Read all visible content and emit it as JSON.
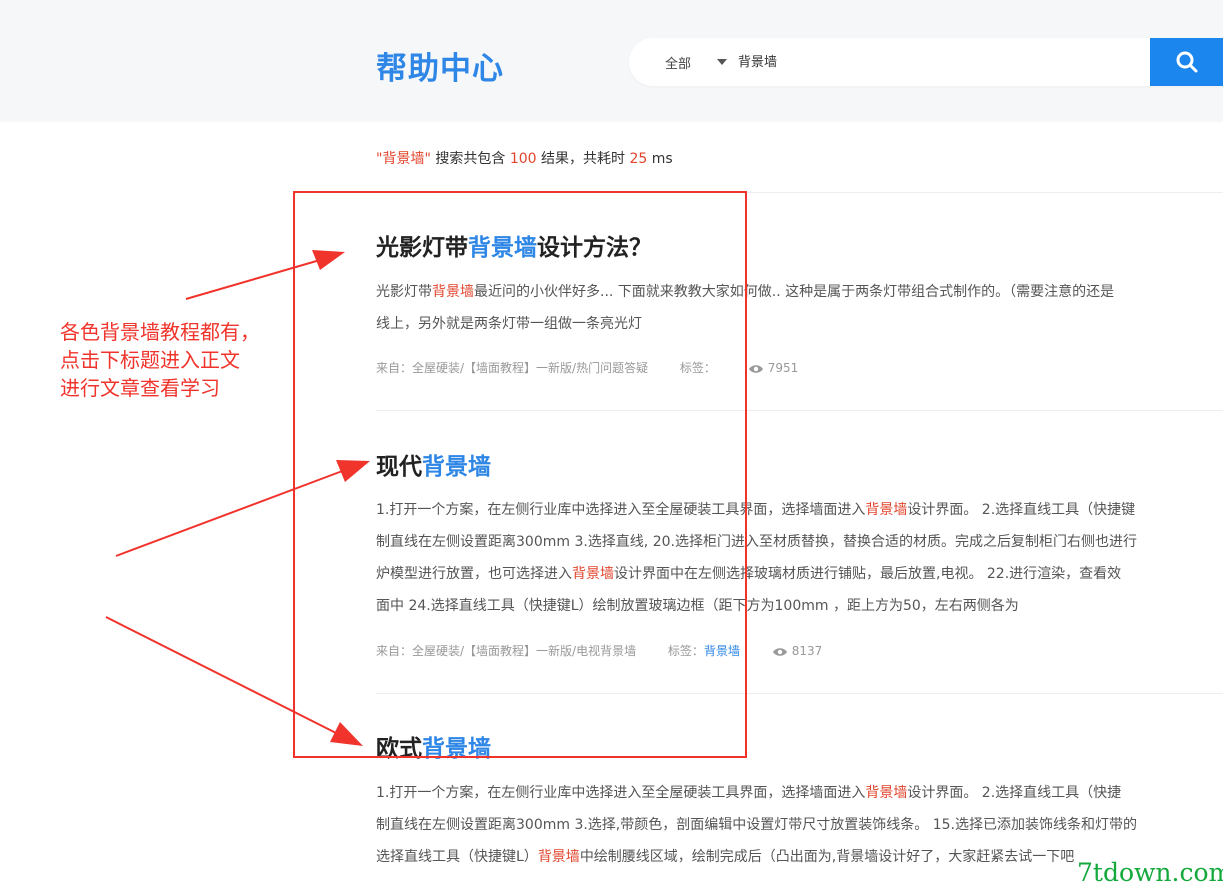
{
  "header": {
    "title": "帮助中心",
    "search_scope": "全部",
    "search_value": "背景墙"
  },
  "summary": {
    "quote_open": "\"",
    "keyword": "背景墙",
    "quote_close": "\"",
    "text1": " 搜索共包含 ",
    "count": "100",
    "text2": " 结果，共耗时 ",
    "time": "25",
    "unit": " ms"
  },
  "results": [
    {
      "title_pre": "光影灯带",
      "title_hl": "背景墙",
      "title_post": "设计方法？",
      "lines": [
        {
          "pre": "光影灯带",
          "hl": "背景墙",
          "post": "最近问的小伙伴好多... 下面就来教教大家如何做.. 这种是属于两条灯带组合式制作的。（需要注意的还是"
        },
        {
          "pre": "线上，另外就是两条灯带一组做一条亮光灯",
          "hl": "",
          "post": ""
        }
      ],
      "source": "来自：全屋硬装/【墙面教程】一新版/热门问题答疑",
      "tag_label": "标签：",
      "tag": "",
      "views": "7951"
    },
    {
      "title_pre": "现代",
      "title_hl": "背景墙",
      "title_post": "",
      "lines": [
        {
          "pre": "1.打开一个方案，在左侧行业库中选择进入至全屋硬装工具界面，选择墙面进入",
          "hl": "背景墙",
          "post": "设计界面。 2.选择直线工具（快捷键"
        },
        {
          "pre": "制直线在左侧设置距离300mm 3.选择直线, 20.选择柜门进入至材质替换，替换合适的材质。完成之后复制柜门右侧也进行",
          "hl": "",
          "post": ""
        },
        {
          "pre": "炉模型进行放置，也可选择进入",
          "hl": "背景墙",
          "post": "设计界面中在左侧选择玻璃材质进行铺贴，最后放置,电视。 22.进行渲染，查看效"
        },
        {
          "pre": "面中 24.选择直线工具（快捷键L）绘制放置玻璃边框（距下方为100mm ，距上方为50，左右两侧各为",
          "hl": "",
          "post": ""
        }
      ],
      "source": "来自：全屋硬装/【墙面教程】一新版/电视背景墙",
      "tag_label": "标签：",
      "tag": "背景墙",
      "views": "8137"
    },
    {
      "title_pre": "欧式",
      "title_hl": "背景墙",
      "title_post": "",
      "lines": [
        {
          "pre": "1.打开一个方案，在左侧行业库中选择进入至全屋硬装工具界面，选择墙面进入",
          "hl": "背景墙",
          "post": "设计界面。 2.选择直线工具（快捷"
        },
        {
          "pre": "制直线在左侧设置距离300mm 3.选择,带颜色，剖面编辑中设置灯带尺寸放置装饰线条。 15.选择已添加装饰线条和灯带的",
          "hl": "",
          "post": ""
        },
        {
          "pre": "选择直线工具（快捷键L）",
          "hl": "背景墙",
          "post": "中绘制腰线区域，绘制完成后（凸出面为,背景墙设计好了，大家赶紧去试一下吧"
        }
      ],
      "source": "",
      "tag_label": "",
      "tag": "",
      "views": ""
    }
  ],
  "annotation": {
    "lines": [
      "各色背景墙教程都有，",
      "点击下标题进入正文",
      "进行文章查看学习"
    ],
    "color": "#f0342c"
  },
  "watermark": "7tdown.com",
  "colors": {
    "brand": "#2e86e6",
    "highlight": "#e2452d",
    "search_button": "#1a86ee"
  },
  "icons": {
    "search": "search-icon",
    "views": "eye-icon",
    "dropdown": "caret-down-icon"
  }
}
